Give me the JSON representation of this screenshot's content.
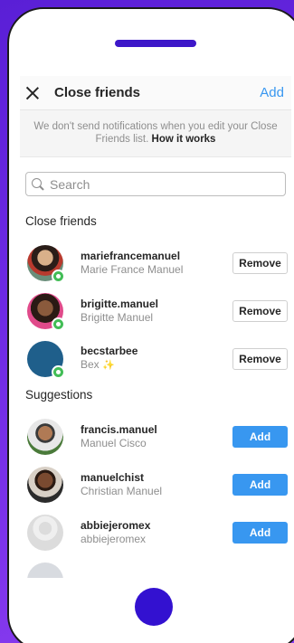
{
  "header": {
    "title": "Close friends",
    "add_label": "Add"
  },
  "notice": {
    "text": "We don't send notifications when you edit your Close Friends list.",
    "link": "How it works"
  },
  "search": {
    "placeholder": "Search"
  },
  "close_friends": {
    "title": "Close friends",
    "items": [
      {
        "username": "mariefrancemanuel",
        "fullname": "Marie France Manuel",
        "action": "Remove"
      },
      {
        "username": "brigitte.manuel",
        "fullname": "Brigitte Manuel",
        "action": "Remove"
      },
      {
        "username": "becstarbee",
        "fullname": "Bex",
        "action": "Remove"
      }
    ]
  },
  "suggestions": {
    "title": "Suggestions",
    "items": [
      {
        "username": "francis.manuel",
        "fullname": "Manuel Cisco",
        "action": "Add"
      },
      {
        "username": "manuelchist",
        "fullname": "Christian Manuel",
        "action": "Add"
      },
      {
        "username": "abbiejeromex",
        "fullname": "abbiejeromex",
        "action": "Add"
      }
    ]
  },
  "colors": {
    "accent": "#3897f0",
    "badge": "#42bd56",
    "home_button": "#3311d0",
    "speaker": "#3d17c9"
  },
  "icons": {
    "close": "close-icon",
    "search": "search-icon",
    "close_friend_badge": "green-star-badge-icon",
    "sparkle": "sparkle-icon"
  }
}
